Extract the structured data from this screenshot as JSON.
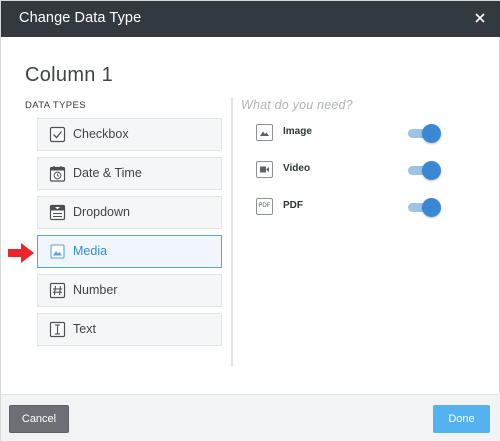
{
  "dialog": {
    "title": "Change Data Type",
    "column_name": "Column 1"
  },
  "data_types": {
    "heading": "DATA TYPES",
    "items": [
      {
        "label": "Checkbox",
        "icon": "checkbox-icon",
        "selected": false
      },
      {
        "label": "Date & Time",
        "icon": "calendar-clock-icon",
        "selected": false
      },
      {
        "label": "Dropdown",
        "icon": "dropdown-icon",
        "selected": false
      },
      {
        "label": "Media",
        "icon": "media-image-icon",
        "selected": true
      },
      {
        "label": "Number",
        "icon": "hash-icon",
        "selected": false
      },
      {
        "label": "Text",
        "icon": "text-cursor-icon",
        "selected": false
      }
    ]
  },
  "options": {
    "heading": "What do you need?",
    "items": [
      {
        "label": "Image",
        "icon": "image-icon",
        "enabled": true
      },
      {
        "label": "Video",
        "icon": "video-icon",
        "enabled": true
      },
      {
        "label": "PDF",
        "icon": "pdf-icon",
        "icon_text": "PDF",
        "enabled": true
      }
    ]
  },
  "footer": {
    "cancel_label": "Cancel",
    "done_label": "Done"
  },
  "colors": {
    "header_bg": "#32393f",
    "accent": "#3a87d3",
    "selected_border": "#5aa6dc",
    "done_bg": "#55b2f1",
    "cancel_bg": "#6c7074",
    "arrow": "#e8262b"
  }
}
